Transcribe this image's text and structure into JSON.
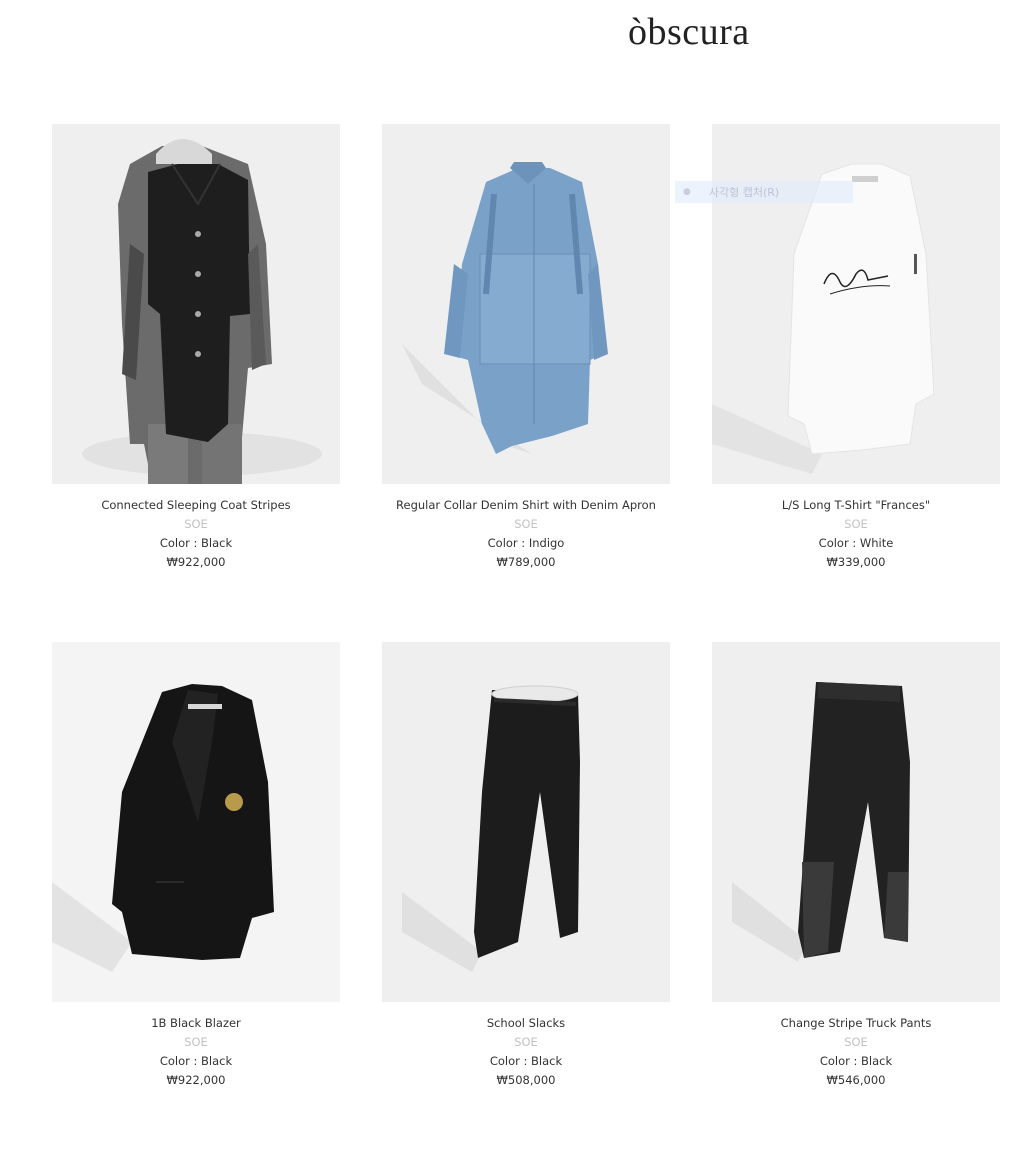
{
  "header": {
    "logo": "òbscura"
  },
  "products": [
    {
      "name": "Connected Sleeping Coat Stripes",
      "brand": "SOE",
      "color": "Color : Black",
      "price": "₩922,000"
    },
    {
      "name": "Regular Collar Denim Shirt with Denim Apron",
      "brand": "SOE",
      "color": "Color : Indigo",
      "price": "₩789,000"
    },
    {
      "name": "L/S Long T-Shirt \"Frances\"",
      "brand": "SOE",
      "color": "Color : White",
      "price": "₩339,000"
    },
    {
      "name": "1B Black Blazer",
      "brand": "SOE",
      "color": "Color : Black",
      "price": "₩922,000"
    },
    {
      "name": "School Slacks",
      "brand": "SOE",
      "color": "Color : Black",
      "price": "₩508,000"
    },
    {
      "name": "Change Stripe Truck Pants",
      "brand": "SOE",
      "color": "Color : Black",
      "price": "₩546,000"
    }
  ],
  "overlay": {
    "capture_label": "사각형 캡처(R)"
  }
}
